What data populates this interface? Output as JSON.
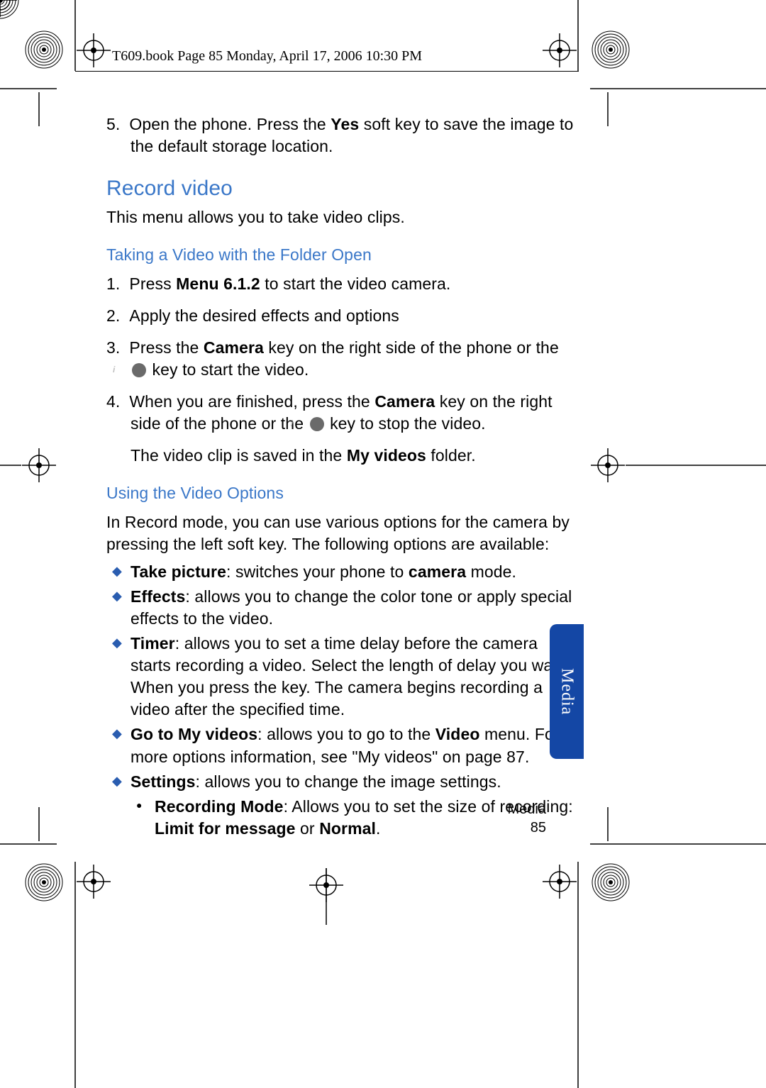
{
  "header": {
    "running_head": "T609.book  Page 85  Monday, April 17, 2006  10:30 PM"
  },
  "step5": {
    "num": "5.",
    "text_before_bold": "Open the phone. Press the ",
    "bold": "Yes",
    "text_after_bold": " soft key to save the image to the default storage location."
  },
  "record_video": {
    "heading": "Record video",
    "intro": "This menu allows you to take video clips.",
    "sub1": {
      "heading": "Taking a Video with the Folder Open",
      "steps": [
        {
          "num": "1.",
          "pre": "Press ",
          "b1": "Menu 6.1.2",
          "post": " to start the video camera."
        },
        {
          "num": "2.",
          "pre": "Apply the desired effects and options",
          "b1": "",
          "post": ""
        },
        {
          "num": "3.",
          "pre": "Press the ",
          "b1": "Camera",
          "post": " key on the right side of the phone or the ",
          "has_icon": true,
          "tail": " key to start the video."
        },
        {
          "num": "4.",
          "pre": "When you are finished, press the ",
          "b1": "Camera",
          "post": " key on the right side of the phone or the ",
          "has_icon": true,
          "tail": " key to stop the video."
        }
      ],
      "after": {
        "pre": "The video clip is saved in the ",
        "b": "My videos",
        "post": " folder."
      }
    },
    "sub2": {
      "heading": "Using the Video Options",
      "intro": "In Record mode, you can use various options for the camera by pressing the left soft key. The following options are available:",
      "items": [
        {
          "b": "Take picture",
          "colon": ": switches your phone to ",
          "b2": "camera",
          "post": " mode."
        },
        {
          "b": "Effects",
          "colon": ": allows you to change the color tone or apply special effects to the video.",
          "b2": "",
          "post": ""
        },
        {
          "b": "Timer",
          "colon": ": allows you to set a time delay before the camera starts recording a video. Select the length of delay you want. When you press the key. The camera begins recording a video after the specified time.",
          "b2": "",
          "post": ""
        },
        {
          "b": "Go to My videos",
          "colon": ": allows you to go to the ",
          "b2": "Video",
          "post": " menu. For more options information, see \"My videos\" on page 87."
        },
        {
          "b": "Settings",
          "colon": ": allows you to change the image settings.",
          "b2": "",
          "post": "",
          "sub": {
            "b": "Recording Mode",
            "text": ": Allows you to set the size of recording: ",
            "b2": "Limit for message",
            "or": " or ",
            "b3": "Normal",
            "dot": "."
          }
        }
      ]
    }
  },
  "side_tab": "Media",
  "footer": {
    "section": "Media",
    "page": "85"
  }
}
